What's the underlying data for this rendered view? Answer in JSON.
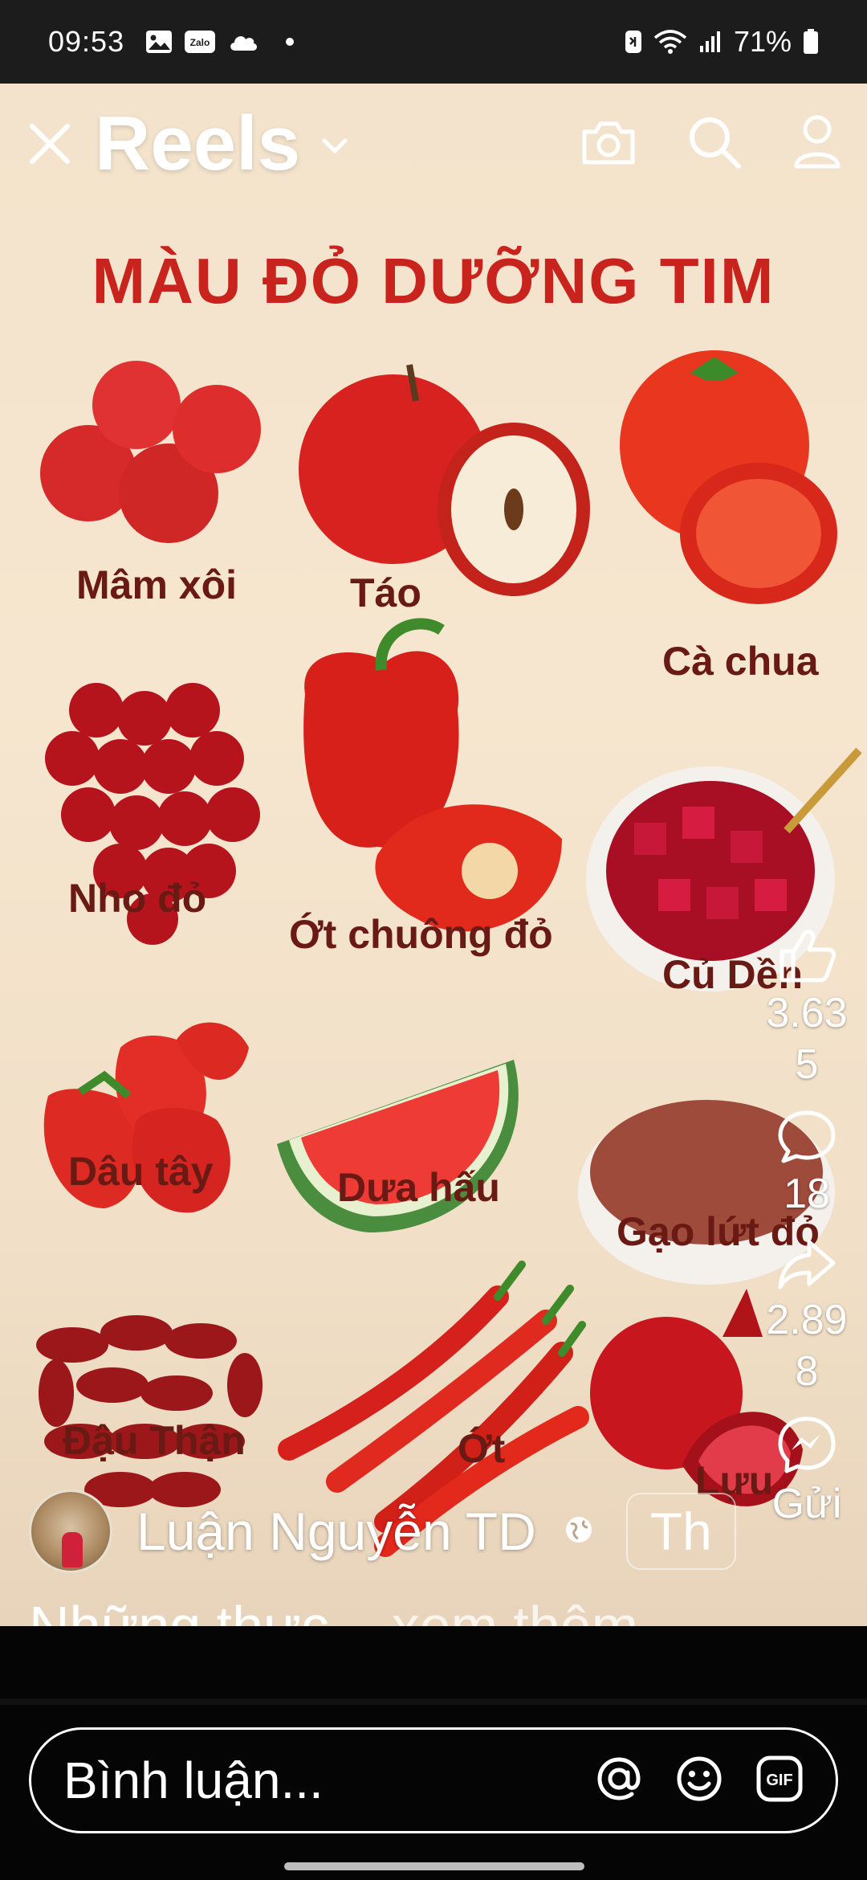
{
  "status_bar": {
    "time": "09:53",
    "battery": "71%",
    "left_icons": [
      "gallery-icon",
      "zalo-icon",
      "cloud-icon",
      "dot-icon"
    ],
    "zalo_text": "Zalo",
    "right_icons": [
      "nfc-icon",
      "wifi-icon",
      "signal-icon",
      "battery-icon"
    ]
  },
  "header": {
    "title": "Reels",
    "icons": [
      "close-icon",
      "chevron-down-icon",
      "camera-icon",
      "search-icon",
      "profile-icon"
    ]
  },
  "poster": {
    "title": "MÀU ĐỎ DƯỠNG TIM",
    "foods": [
      "Mâm xôi",
      "Táo",
      "Cà chua",
      "Nho đỏ",
      "Ớt chuông đỏ",
      "Củ Dền",
      "Dâu tây",
      "Dưa hấu",
      "Gạo lứt đỏ",
      "Đậu Thận",
      "Ớt",
      "Lựu"
    ]
  },
  "actions": {
    "likes": "3.63\n5",
    "comments": "18",
    "shares": "2.89\n8",
    "send_label": "Gửi"
  },
  "author": {
    "name": "Luận Nguyễn TD",
    "follow": "Th"
  },
  "caption": {
    "text": "Những thực...",
    "more": "xem thêm",
    "dots": "..."
  },
  "comment_bar": {
    "placeholder": "Bình luận...",
    "gif_label": "GIF"
  },
  "colors": {
    "poster_bg": "#f3e3cc",
    "poster_title": "#c9231d",
    "label_color": "#6a1a14"
  }
}
